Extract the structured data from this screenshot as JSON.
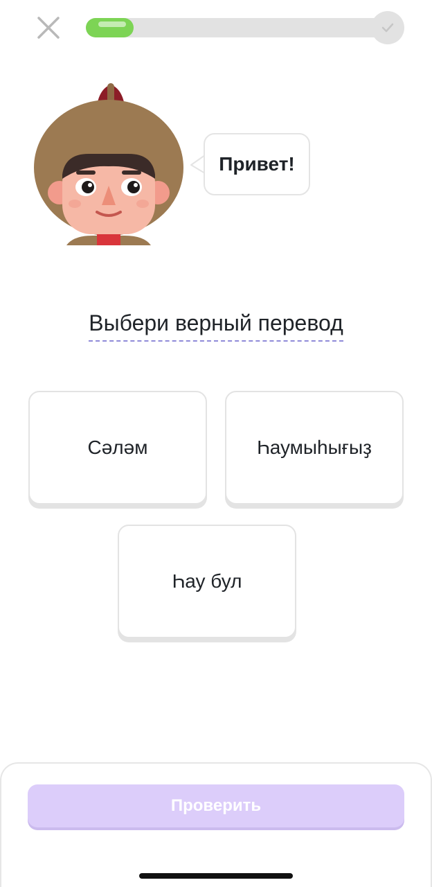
{
  "top_bar": {
    "close_icon": "close-icon",
    "progress": 0.155,
    "progress_color": "#7dd455",
    "progress_end_icon": "checkmark-icon"
  },
  "character": {
    "illustration": "character-illustration",
    "speech": "Привет!"
  },
  "instruction": "Выбери верный перевод",
  "options": [
    {
      "label": "Сәләм"
    },
    {
      "label": "Һаумыһығыҙ"
    },
    {
      "label": "Һау бул"
    }
  ],
  "footer": {
    "check_button": "Проверить",
    "check_button_color": "#dccdfa"
  }
}
